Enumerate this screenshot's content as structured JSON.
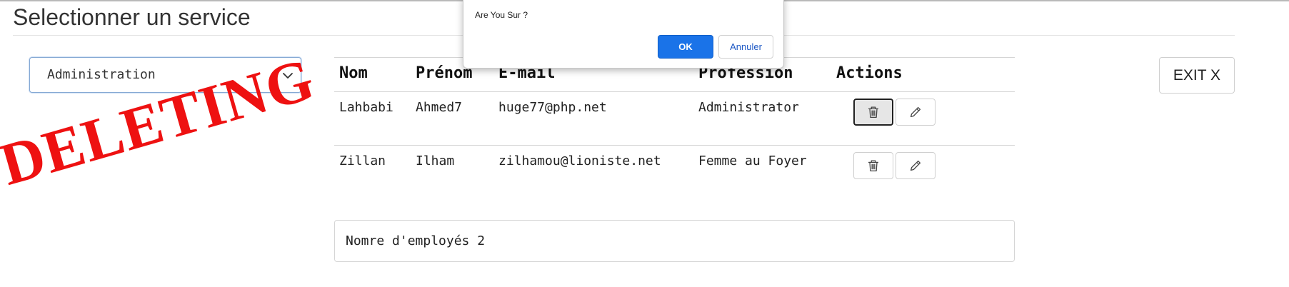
{
  "page": {
    "title": "Selectionner un service"
  },
  "service_select": {
    "selected": "Administration"
  },
  "exit_button": {
    "label": "EXIT X"
  },
  "table": {
    "headers": [
      "Nom",
      "Prénom",
      "E-mail",
      "Profession",
      "Actions"
    ],
    "rows": [
      {
        "nom": "Lahbabi",
        "prenom": "Ahmed7",
        "email": "huge77@php.net",
        "profession": "Administrator"
      },
      {
        "nom": "Zillan",
        "prenom": "Ilham",
        "email": "zilhamou@lioniste.net",
        "profession": "Femme au Foyer"
      }
    ]
  },
  "count": {
    "text": "Nomre d'employés 2"
  },
  "stamp": {
    "text": "DELETING",
    "color": "#ee1111"
  },
  "dialog": {
    "message": "Are You Sur ?",
    "ok_label": "OK",
    "cancel_label": "Annuler"
  },
  "icons": {
    "delete": "trash-icon",
    "edit": "pencil-icon",
    "dropdown": "chevron-down-icon"
  },
  "colors": {
    "primary_button": "#1a73e8",
    "stamp_red": "#ee1111"
  }
}
